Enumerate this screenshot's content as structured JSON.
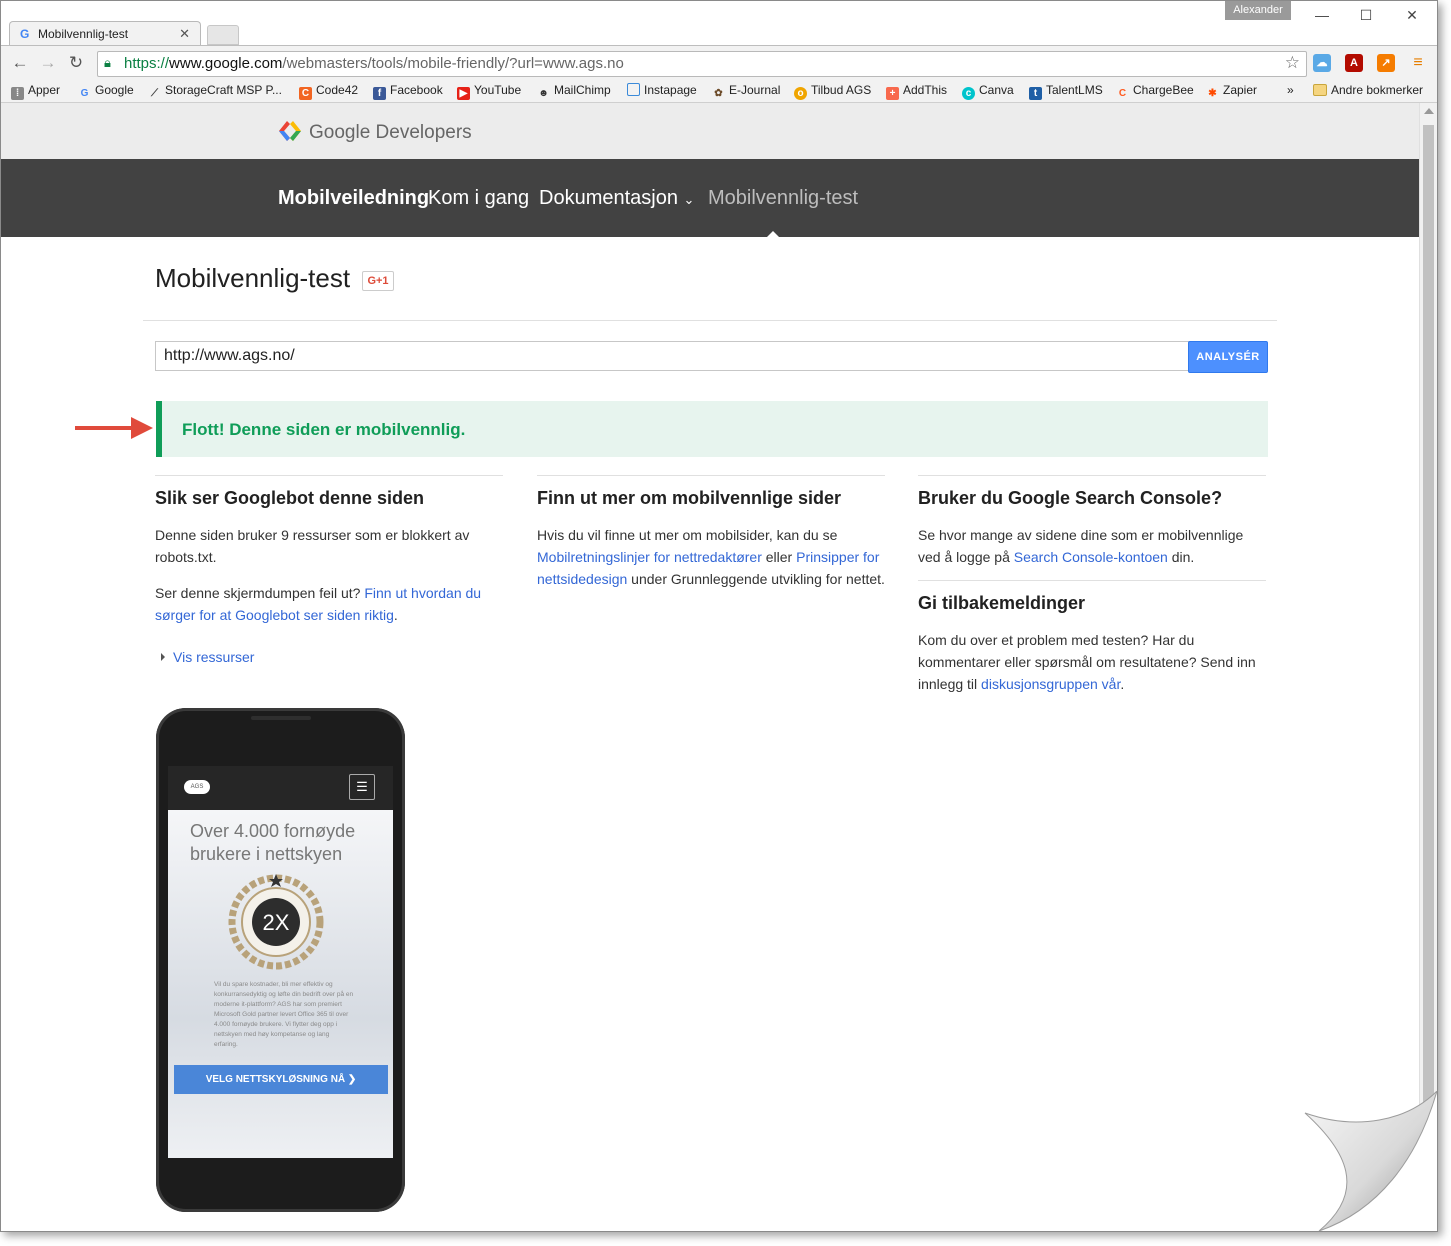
{
  "browser": {
    "tab_title": "Mobilvennlig-test",
    "user": "Alexander",
    "url_scheme": "https://",
    "url_host": "www.google.com",
    "url_path": "/webmasters/tools/mobile-friendly/?url=www.ags.no"
  },
  "bookmarks": {
    "items": [
      "Apper",
      "Google",
      "StorageCraft MSP P...",
      "Code42",
      "Facebook",
      "YouTube",
      "MailChimp",
      "Instapage",
      "E-Journal",
      "Tilbud AGS",
      "AddThis",
      "Canva",
      "TalentLMS",
      "ChargeBee",
      "Zapier"
    ],
    "more": "»",
    "other_bookmarks": "Andre bokmerker"
  },
  "site": {
    "logo_text": "Google Developers",
    "nav": [
      "Mobilveiledning",
      "Kom i gang",
      "Dokumentasjon",
      "Mobilvennlig-test"
    ]
  },
  "main": {
    "title": "Mobilvennlig-test",
    "gplus": "G+1",
    "url_value": "http://www.ags.no/",
    "analyze_button": "ANALYSÉR",
    "result_text": "Flott! Denne siden er mobilvennlig."
  },
  "columns": {
    "googlebot": {
      "heading": "Slik ser Googlebot denne siden",
      "p1": "Denne siden bruker 9 ressurser som er blokkert av robots.txt.",
      "p2_text": "Ser denne skjermdumpen feil ut? ",
      "p2_link": "Finn ut hvordan du sørger for at Googlebot ser siden riktig",
      "p2_end": ".",
      "show_resources": "Vis ressurser"
    },
    "learn": {
      "heading": "Finn ut mer om mobilvennlige sider",
      "text1": "Hvis du vil finne ut mer om mobilsider, kan du se ",
      "link1": "Mobilretningslinjer for nettredaktører",
      "text2": " eller ",
      "link2": "Prinsipper for nettsidedesign",
      "text3": " under Grunnleggende utvikling for nettet."
    },
    "console": {
      "heading": "Bruker du Google Search Console?",
      "text1": "Se hvor mange av sidene dine som er mobilvennlige ved å logge på ",
      "link": "Search Console-kontoen",
      "text2": " din."
    },
    "feedback": {
      "heading": "Gi tilbakemeldinger",
      "text1": "Kom du over et problem med testen? Har du kommentarer eller spørsmål om resultatene? Send inn innlegg til ",
      "link": "diskusjonsgruppen vår",
      "text2": "."
    }
  },
  "phone_preview": {
    "logo": "AGS",
    "headline": "Over 4.000 fornøyde brukere i nettskyen",
    "badge_text": "2X",
    "body": "Vil du spare kostnader, bli mer effektiv og konkurransedyktig og løfte din bedrift over på en moderne it-plattform? AGS har som premiert Microsoft Gold partner levert Office 365 til over 4.000 fornøyde brukere. Vi flytter deg opp i nettskyen med høy kompetanse og lang erfaring.",
    "cta": "VELG NETTSKYLØSNING NÅ ❯"
  }
}
